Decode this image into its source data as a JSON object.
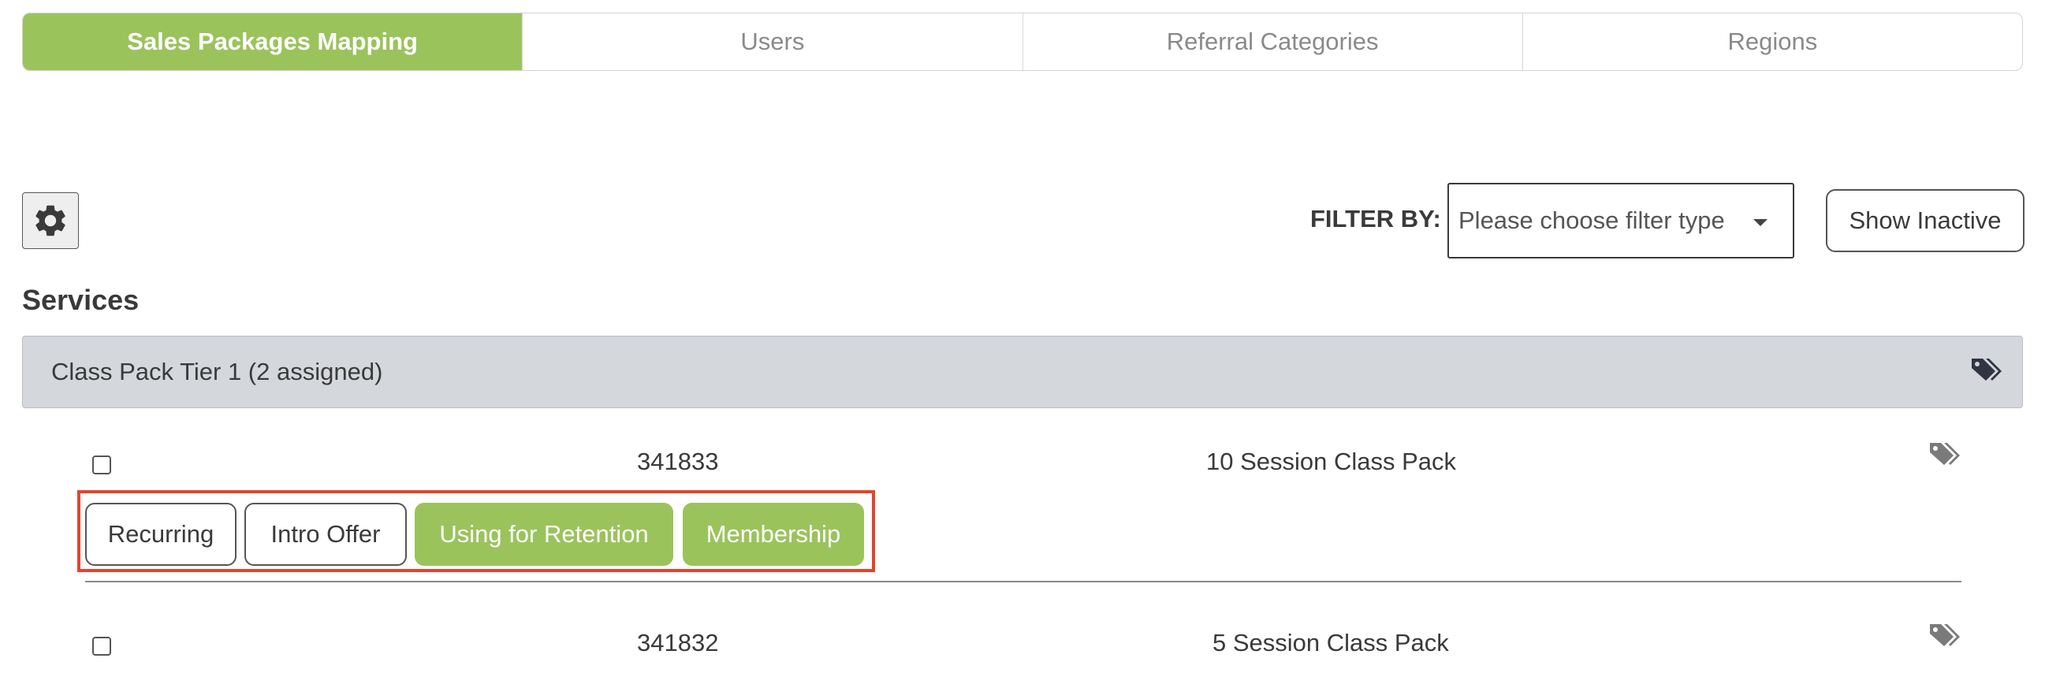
{
  "tabs": [
    {
      "label": "Sales Packages Mapping",
      "active": true
    },
    {
      "label": "Users",
      "active": false
    },
    {
      "label": "Referral Categories",
      "active": false
    },
    {
      "label": "Regions",
      "active": false
    }
  ],
  "toolbar": {
    "settings_icon": "gear-icon",
    "filter_label": "FILTER BY:",
    "filter_placeholder": "Please choose filter type",
    "show_inactive_label": "Show Inactive"
  },
  "section": {
    "title": "Services"
  },
  "group": {
    "label": "Class Pack Tier 1 (2 assigned)",
    "icon": "tags-icon"
  },
  "rows": [
    {
      "id": "341833",
      "name": "10 Session Class Pack",
      "icon": "tags-icon",
      "tags": [
        {
          "label": "Recurring",
          "active": false
        },
        {
          "label": "Intro Offer",
          "active": false
        },
        {
          "label": "Using for Retention",
          "active": true
        },
        {
          "label": "Membership",
          "active": true
        }
      ]
    },
    {
      "id": "341832",
      "name": "5 Session Class Pack",
      "icon": "tags-icon"
    }
  ],
  "colors": {
    "accent_green": "#9bc35c",
    "highlight_red": "#e2452f",
    "group_header_bg": "#d4d7dc"
  }
}
